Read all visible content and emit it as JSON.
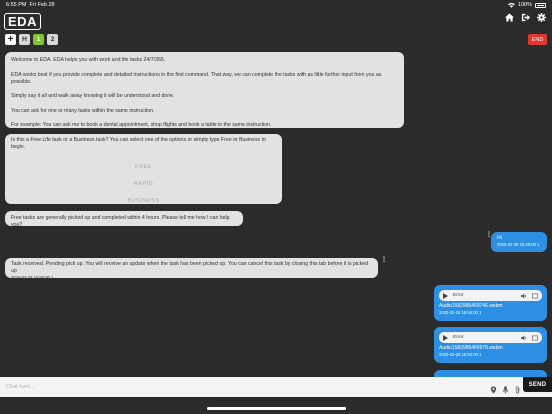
{
  "status_bar": {
    "time": "6:55 PM",
    "date": "Fri Feb 28",
    "battery": "100%"
  },
  "header": {
    "logo": "EDA",
    "icons": [
      "home-icon",
      "logout-icon",
      "gear-icon"
    ]
  },
  "toolbar": {
    "add_label": "+",
    "tabs": [
      {
        "label": "H"
      },
      {
        "label": "1"
      },
      {
        "label": "2"
      }
    ],
    "end_label": "END"
  },
  "messages": {
    "welcome": [
      "Welcome to EDA. EDA helps you with work and life tasks 24/7/365.",
      "EDA works best if you provide complete and detailed instructions in the first command. That way, we can complete the tasks with as little further input from you as possible.",
      "Simply say it all and walk away knowing it will be understood and done.",
      "You can ask for one or many tasks within the same instruction.",
      "For example: You can ask me to book a dental appointment, shop flights and book a table in the same instruction."
    ],
    "task_type": {
      "question": "Is this a Free Life task or a Business task? You can select one of the options or simply type Free or Business to begin.",
      "options": [
        "FREE",
        "RAPID",
        "BUSINESS"
      ]
    },
    "free_info": "Free tasks are generally picked up and completed within 4 hours. Please tell me how I can help you?",
    "user_hi": {
      "text": "Hi",
      "timestamp": "2020-02-28 15:49:00 1"
    },
    "task_received": {
      "text": "Task received. Pending pick up. You will receive an update when the task has been picked up. You can cancel this task by closing this tab before it is picked up",
      "timestamp": "2020-02-28 15:50:00 1"
    },
    "audio": [
      {
        "player_text": "Error",
        "filename": "Audio1582985459746.webm",
        "timestamp": "2020-02-28 15:54:00 1"
      },
      {
        "player_text": "Error",
        "filename": "Audio1582985466979.webm",
        "timestamp": "2020-02-28 15:54:00 1"
      }
    ]
  },
  "input_bar": {
    "placeholder": "Chat here...",
    "value": "",
    "icons": [
      "location-icon",
      "microphone-icon",
      "paperclip-icon"
    ],
    "send_label": "SEND"
  },
  "colors": {
    "background": "#2b2b2b",
    "bot_bubble": "#e2e2e2",
    "user_bubble": "#2d8fe3",
    "end_button": "#e0392b",
    "active_tab": "#86c332"
  }
}
